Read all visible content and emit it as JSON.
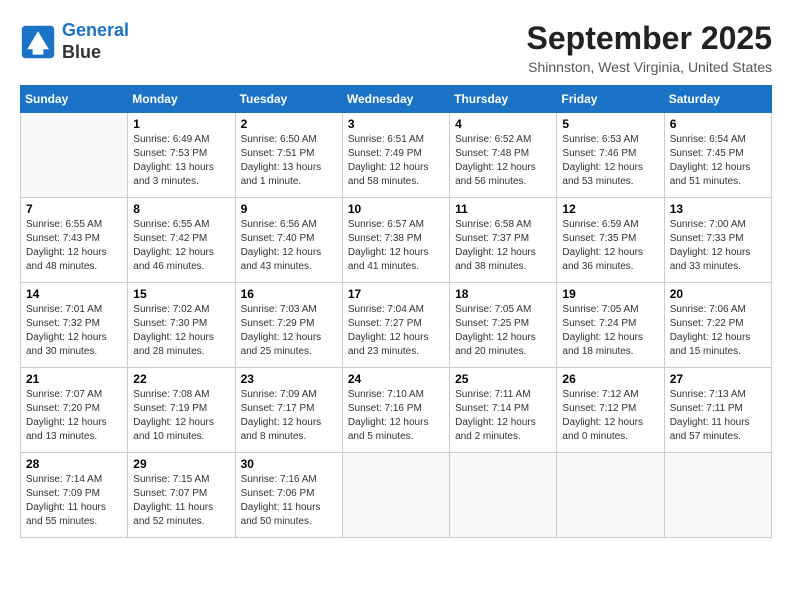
{
  "header": {
    "logo_line1": "General",
    "logo_line2": "Blue",
    "month": "September 2025",
    "location": "Shinnston, West Virginia, United States"
  },
  "weekdays": [
    "Sunday",
    "Monday",
    "Tuesday",
    "Wednesday",
    "Thursday",
    "Friday",
    "Saturday"
  ],
  "weeks": [
    [
      {
        "day": "",
        "sunrise": "",
        "sunset": "",
        "daylight": ""
      },
      {
        "day": "1",
        "sunrise": "Sunrise: 6:49 AM",
        "sunset": "Sunset: 7:53 PM",
        "daylight": "Daylight: 13 hours and 3 minutes."
      },
      {
        "day": "2",
        "sunrise": "Sunrise: 6:50 AM",
        "sunset": "Sunset: 7:51 PM",
        "daylight": "Daylight: 13 hours and 1 minute."
      },
      {
        "day": "3",
        "sunrise": "Sunrise: 6:51 AM",
        "sunset": "Sunset: 7:49 PM",
        "daylight": "Daylight: 12 hours and 58 minutes."
      },
      {
        "day": "4",
        "sunrise": "Sunrise: 6:52 AM",
        "sunset": "Sunset: 7:48 PM",
        "daylight": "Daylight: 12 hours and 56 minutes."
      },
      {
        "day": "5",
        "sunrise": "Sunrise: 6:53 AM",
        "sunset": "Sunset: 7:46 PM",
        "daylight": "Daylight: 12 hours and 53 minutes."
      },
      {
        "day": "6",
        "sunrise": "Sunrise: 6:54 AM",
        "sunset": "Sunset: 7:45 PM",
        "daylight": "Daylight: 12 hours and 51 minutes."
      }
    ],
    [
      {
        "day": "7",
        "sunrise": "Sunrise: 6:55 AM",
        "sunset": "Sunset: 7:43 PM",
        "daylight": "Daylight: 12 hours and 48 minutes."
      },
      {
        "day": "8",
        "sunrise": "Sunrise: 6:55 AM",
        "sunset": "Sunset: 7:42 PM",
        "daylight": "Daylight: 12 hours and 46 minutes."
      },
      {
        "day": "9",
        "sunrise": "Sunrise: 6:56 AM",
        "sunset": "Sunset: 7:40 PM",
        "daylight": "Daylight: 12 hours and 43 minutes."
      },
      {
        "day": "10",
        "sunrise": "Sunrise: 6:57 AM",
        "sunset": "Sunset: 7:38 PM",
        "daylight": "Daylight: 12 hours and 41 minutes."
      },
      {
        "day": "11",
        "sunrise": "Sunrise: 6:58 AM",
        "sunset": "Sunset: 7:37 PM",
        "daylight": "Daylight: 12 hours and 38 minutes."
      },
      {
        "day": "12",
        "sunrise": "Sunrise: 6:59 AM",
        "sunset": "Sunset: 7:35 PM",
        "daylight": "Daylight: 12 hours and 36 minutes."
      },
      {
        "day": "13",
        "sunrise": "Sunrise: 7:00 AM",
        "sunset": "Sunset: 7:33 PM",
        "daylight": "Daylight: 12 hours and 33 minutes."
      }
    ],
    [
      {
        "day": "14",
        "sunrise": "Sunrise: 7:01 AM",
        "sunset": "Sunset: 7:32 PM",
        "daylight": "Daylight: 12 hours and 30 minutes."
      },
      {
        "day": "15",
        "sunrise": "Sunrise: 7:02 AM",
        "sunset": "Sunset: 7:30 PM",
        "daylight": "Daylight: 12 hours and 28 minutes."
      },
      {
        "day": "16",
        "sunrise": "Sunrise: 7:03 AM",
        "sunset": "Sunset: 7:29 PM",
        "daylight": "Daylight: 12 hours and 25 minutes."
      },
      {
        "day": "17",
        "sunrise": "Sunrise: 7:04 AM",
        "sunset": "Sunset: 7:27 PM",
        "daylight": "Daylight: 12 hours and 23 minutes."
      },
      {
        "day": "18",
        "sunrise": "Sunrise: 7:05 AM",
        "sunset": "Sunset: 7:25 PM",
        "daylight": "Daylight: 12 hours and 20 minutes."
      },
      {
        "day": "19",
        "sunrise": "Sunrise: 7:05 AM",
        "sunset": "Sunset: 7:24 PM",
        "daylight": "Daylight: 12 hours and 18 minutes."
      },
      {
        "day": "20",
        "sunrise": "Sunrise: 7:06 AM",
        "sunset": "Sunset: 7:22 PM",
        "daylight": "Daylight: 12 hours and 15 minutes."
      }
    ],
    [
      {
        "day": "21",
        "sunrise": "Sunrise: 7:07 AM",
        "sunset": "Sunset: 7:20 PM",
        "daylight": "Daylight: 12 hours and 13 minutes."
      },
      {
        "day": "22",
        "sunrise": "Sunrise: 7:08 AM",
        "sunset": "Sunset: 7:19 PM",
        "daylight": "Daylight: 12 hours and 10 minutes."
      },
      {
        "day": "23",
        "sunrise": "Sunrise: 7:09 AM",
        "sunset": "Sunset: 7:17 PM",
        "daylight": "Daylight: 12 hours and 8 minutes."
      },
      {
        "day": "24",
        "sunrise": "Sunrise: 7:10 AM",
        "sunset": "Sunset: 7:16 PM",
        "daylight": "Daylight: 12 hours and 5 minutes."
      },
      {
        "day": "25",
        "sunrise": "Sunrise: 7:11 AM",
        "sunset": "Sunset: 7:14 PM",
        "daylight": "Daylight: 12 hours and 2 minutes."
      },
      {
        "day": "26",
        "sunrise": "Sunrise: 7:12 AM",
        "sunset": "Sunset: 7:12 PM",
        "daylight": "Daylight: 12 hours and 0 minutes."
      },
      {
        "day": "27",
        "sunrise": "Sunrise: 7:13 AM",
        "sunset": "Sunset: 7:11 PM",
        "daylight": "Daylight: 11 hours and 57 minutes."
      }
    ],
    [
      {
        "day": "28",
        "sunrise": "Sunrise: 7:14 AM",
        "sunset": "Sunset: 7:09 PM",
        "daylight": "Daylight: 11 hours and 55 minutes."
      },
      {
        "day": "29",
        "sunrise": "Sunrise: 7:15 AM",
        "sunset": "Sunset: 7:07 PM",
        "daylight": "Daylight: 11 hours and 52 minutes."
      },
      {
        "day": "30",
        "sunrise": "Sunrise: 7:16 AM",
        "sunset": "Sunset: 7:06 PM",
        "daylight": "Daylight: 11 hours and 50 minutes."
      },
      {
        "day": "",
        "sunrise": "",
        "sunset": "",
        "daylight": ""
      },
      {
        "day": "",
        "sunrise": "",
        "sunset": "",
        "daylight": ""
      },
      {
        "day": "",
        "sunrise": "",
        "sunset": "",
        "daylight": ""
      },
      {
        "day": "",
        "sunrise": "",
        "sunset": "",
        "daylight": ""
      }
    ]
  ]
}
